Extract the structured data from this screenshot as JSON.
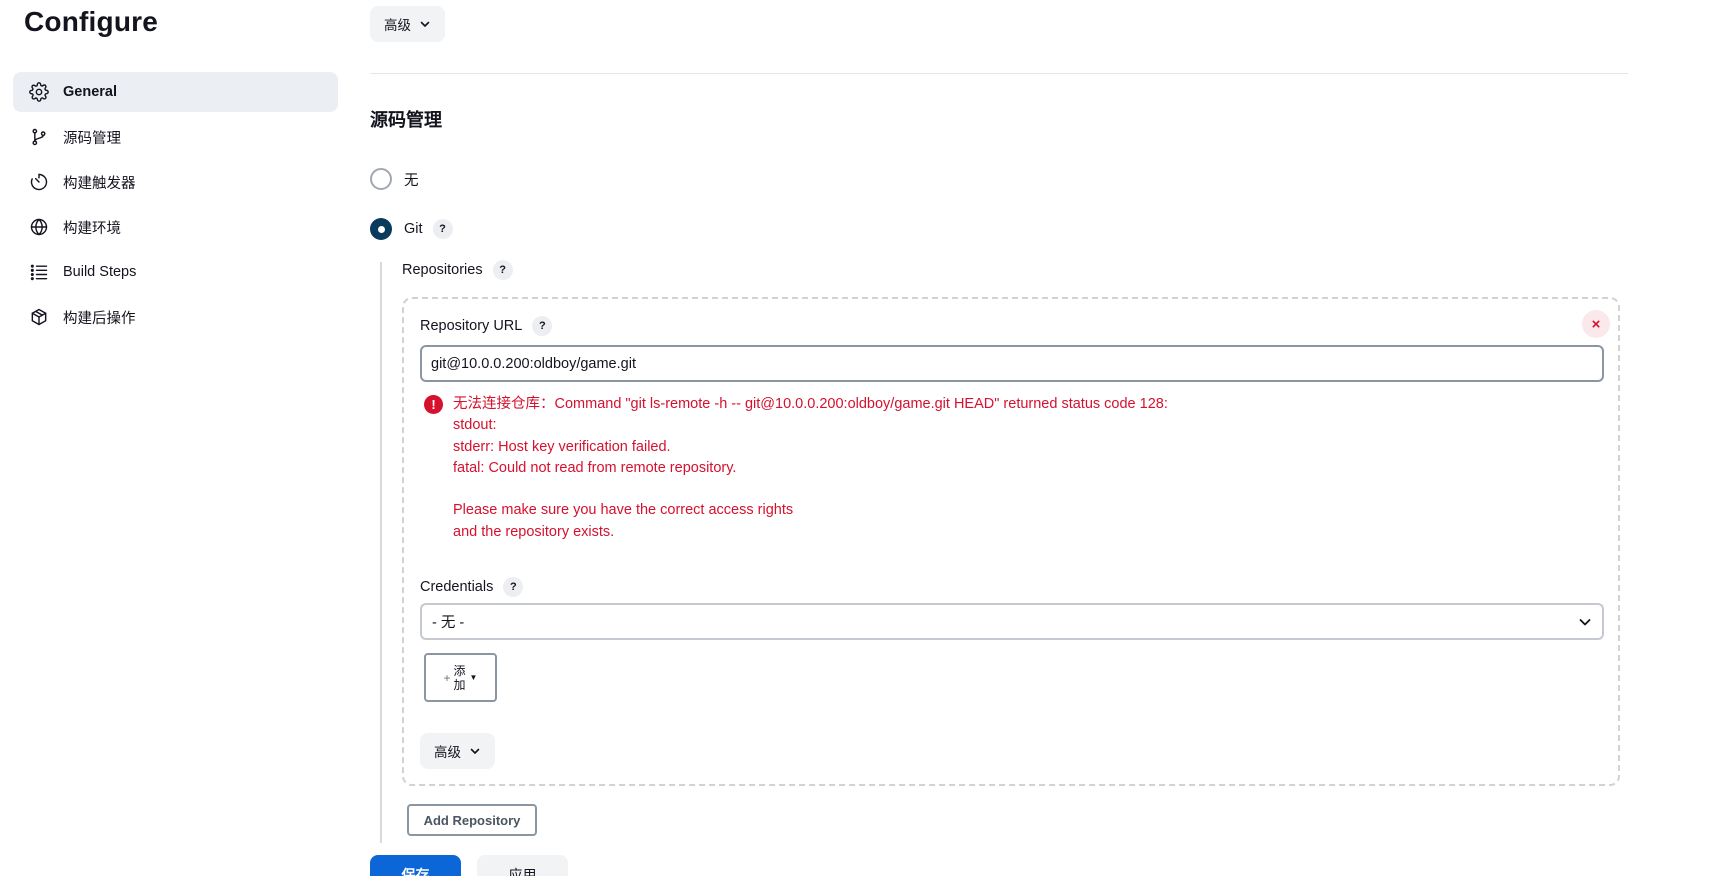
{
  "page": {
    "title": "Configure"
  },
  "sidebar": {
    "items": [
      {
        "label": "General",
        "icon": "gear-icon",
        "active": true
      },
      {
        "label": "源码管理",
        "icon": "branch-icon",
        "active": false
      },
      {
        "label": "构建触发器",
        "icon": "timer-icon",
        "active": false
      },
      {
        "label": "构建环境",
        "icon": "globe-icon",
        "active": false
      },
      {
        "label": "Build Steps",
        "icon": "list-icon",
        "active": false
      },
      {
        "label": "构建后操作",
        "icon": "package-icon",
        "active": false
      }
    ]
  },
  "top": {
    "advanced_label": "高级"
  },
  "scm": {
    "title": "源码管理",
    "option_none": "无",
    "option_git": "Git",
    "selected": "Git",
    "repositories_label": "Repositories",
    "repository": {
      "url_label": "Repository URL",
      "url_value": "git@10.0.0.200:oldboy/game.git",
      "error_lines": [
        "无法连接仓库：Command \"git ls-remote -h -- git@10.0.0.200:oldboy/game.git HEAD\" returned status code 128:",
        "stdout:",
        "stderr: Host key verification failed.",
        "fatal: Could not read from remote repository.",
        "",
        "Please make sure you have the correct access rights",
        "and the repository exists."
      ],
      "credentials_label": "Credentials",
      "credentials_value": "- 无 -",
      "add_label": "添加",
      "advanced_label": "高级",
      "close_symbol": "×",
      "error_symbol": "!"
    },
    "add_repository_label": "Add Repository"
  },
  "help_symbol": "?",
  "footer": {
    "save_label": "保存",
    "apply_label": "应用"
  },
  "colors": {
    "primary": "#0b67d8",
    "error": "#d6112e",
    "radio_checked": "#0b3b5c",
    "active_nav_bg": "#ebeef2"
  }
}
